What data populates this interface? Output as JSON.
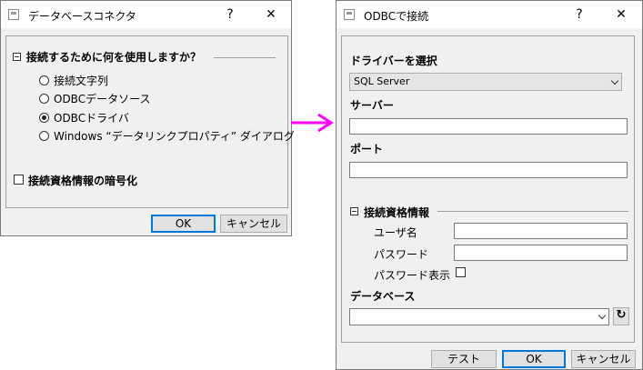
{
  "left_dialog": {
    "title": "データベースコネクタ",
    "help": "?",
    "close": "✕",
    "group_title": "接続するために何を使用しますか？",
    "options": [
      {
        "label": "接続文字列",
        "selected": false
      },
      {
        "label": "ODBCデータソース",
        "selected": false
      },
      {
        "label": "ODBCドライバ",
        "selected": true
      },
      {
        "label": "Windows “データリンクプロパティ” ダイアログ",
        "selected": false
      }
    ],
    "encrypt_label": "接続資格情報の暗号化",
    "ok": "OK",
    "cancel": "キャンセル"
  },
  "arrow_color": "#ff00ff",
  "right_dialog": {
    "title": "ODBCで接続",
    "help": "?",
    "close": "✕",
    "driver_label": "ドライバーを選択",
    "driver_value": "SQL Server",
    "server_label": "サーバー",
    "port_label": "ポート",
    "credentials_label": "接続資格情報",
    "username_label": "ユーザ名",
    "password_label": "パスワード",
    "show_password_label": "パスワード表示",
    "database_label": "データベース",
    "test": "テスト",
    "ok": "OK",
    "cancel": "キャンセル"
  }
}
